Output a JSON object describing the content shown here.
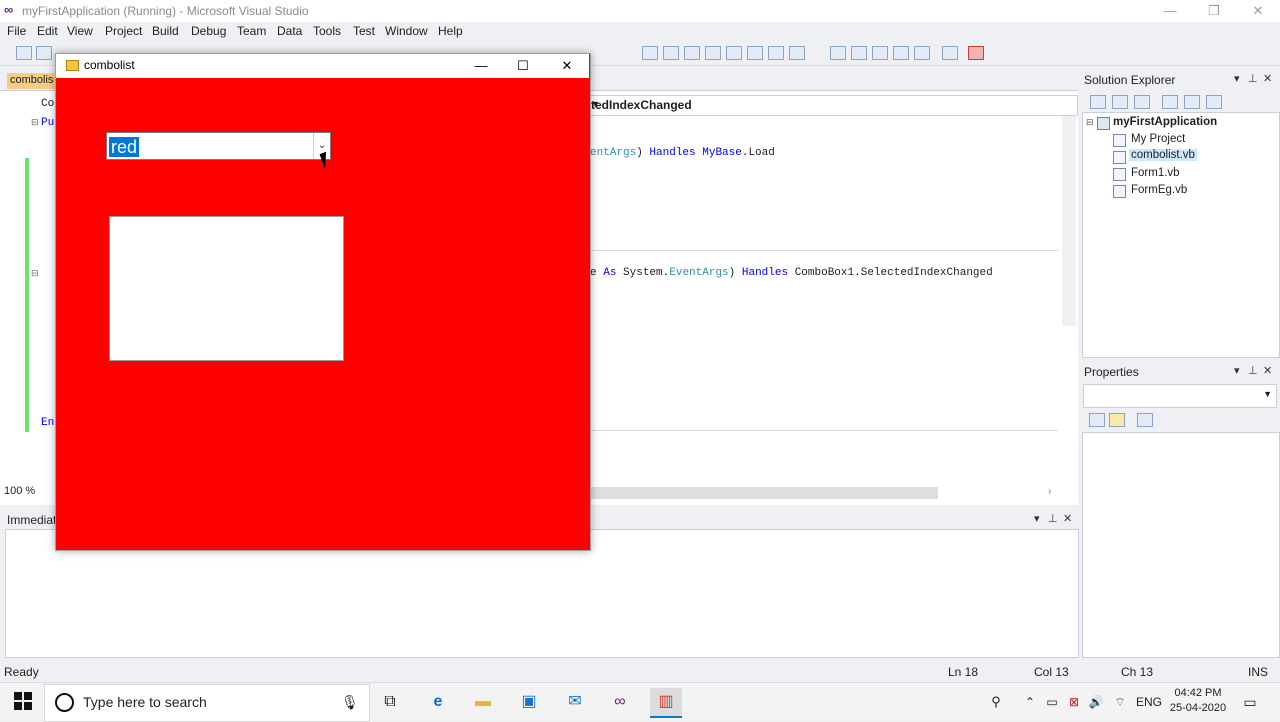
{
  "vs": {
    "title": "myFirstApplication (Running) - Microsoft Visual Studio",
    "menu": [
      "File",
      "Edit",
      "View",
      "Project",
      "Build",
      "Debug",
      "Team",
      "Data",
      "Tools",
      "Test",
      "Window",
      "Help"
    ],
    "doc_tab": "combolis",
    "nav_method": "tedIndexChanged",
    "code": {
      "line1_args": "entArgs",
      "line1_handles": "Handles",
      "line1_mybase": "MyBase",
      "line1_load": ".Load",
      "line2_e": "e",
      "line2_as": "As",
      "line2_system": "System.",
      "line2_eventargs": "EventArgs",
      "line2_handles": "Handles",
      "line2_target": "ComboBox1.SelectedIndexChanged",
      "left_pu": "Pu",
      "left_co": "Co",
      "left_en": "En"
    },
    "zoom": "100 %",
    "immediate_title": "Immediat",
    "solution_explorer": {
      "title": "Solution Explorer",
      "project": "myFirstApplication",
      "items": [
        "My Project",
        "combolist.vb",
        "Form1.vb",
        "FormEg.vb"
      ]
    },
    "properties_title": "Properties",
    "status": {
      "left": "Ready",
      "ln": "Ln 18",
      "col": "Col 13",
      "ch": "Ch 13",
      "mode": "INS"
    }
  },
  "form": {
    "title": "combolist",
    "combo_value": "red",
    "back_color": "#ff0000"
  },
  "taskbar": {
    "search_placeholder": "Type here to search",
    "time": "04:42 PM",
    "date": "25-04-2020",
    "lang": "ENG"
  }
}
